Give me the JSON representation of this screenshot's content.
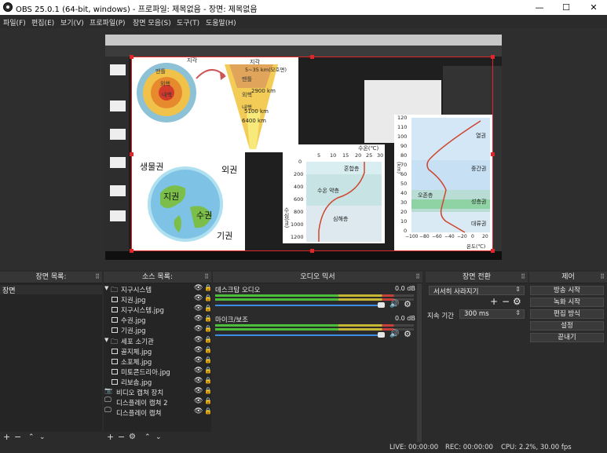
{
  "window": {
    "title": "OBS 25.0.1 (64-bit, windows) - 프로파일: 제목없음 - 장면: 제목없음",
    "minimize": "—",
    "maximize": "☐",
    "close": "✕"
  },
  "menu": [
    "파일(F)",
    "편집(E)",
    "보기(V)",
    "프로파일(P)",
    "장면 모음(S)",
    "도구(T)",
    "도움말(H)"
  ],
  "preview": {
    "slide1": {
      "title": "지각",
      "crust_label": "지각",
      "crust_depth": "5~35 km(모호면)",
      "mantle": "맨틀",
      "outer_core": "외핵",
      "inner_core": "내핵",
      "d1": "2900 km",
      "d2": "5100 km",
      "d3": "6400 km"
    },
    "slide2": {
      "bio": "생물권",
      "outer": "외권",
      "geo": "지권",
      "hydro": "수권",
      "atmo": "기권"
    },
    "slide3": {
      "temp_axis": "수온(℃)",
      "ticks_x": [
        "5",
        "10",
        "15",
        "20",
        "25",
        "30"
      ],
      "ticks_y": [
        "0",
        "200",
        "400",
        "600",
        "800",
        "1000",
        "1200"
      ],
      "depth_axis": "수심(m)",
      "mixed": "혼합층",
      "thermocline": "수온 약층",
      "deep": "심해층"
    },
    "slide4": {
      "alt_axis": "(km)",
      "ticks_y": [
        "120",
        "110",
        "100",
        "90",
        "80",
        "70",
        "60",
        "50",
        "40",
        "30",
        "20",
        "10",
        "0"
      ],
      "ticks_x": [
        "−100",
        "−80",
        "−60",
        "−40",
        "−20",
        "0",
        "20"
      ],
      "temp_axis": "온도(℃)",
      "thermo": "열권",
      "meso": "중간권",
      "ozone": "오존층",
      "strato": "성층권",
      "tropo": "대류권"
    }
  },
  "scenes": {
    "header": "장면 목록:",
    "items": [
      "장면"
    ]
  },
  "sources": {
    "header": "소스 목록:",
    "items": [
      {
        "label": "지구시스템",
        "type": "group"
      },
      {
        "label": "지권.jpg",
        "type": "image"
      },
      {
        "label": "지구시스템.jpg",
        "type": "image"
      },
      {
        "label": "수권.jpg",
        "type": "image"
      },
      {
        "label": "기권.jpg",
        "type": "image"
      },
      {
        "label": "세포 소기관",
        "type": "group"
      },
      {
        "label": "골지체.jpg",
        "type": "image"
      },
      {
        "label": "소포체.jpg",
        "type": "image"
      },
      {
        "label": "미토콘드리아.jpg",
        "type": "image"
      },
      {
        "label": "리보솜.jpg",
        "type": "image"
      },
      {
        "label": "비디오 캡쳐 장치",
        "type": "camera"
      },
      {
        "label": "디스플레이 캡쳐 2",
        "type": "display"
      },
      {
        "label": "디스플레이 캡쳐",
        "type": "display"
      }
    ]
  },
  "mixer": {
    "header": "오디오 믹서",
    "channels": [
      {
        "name": "데스크탑 오디오",
        "db": "0.0 dB",
        "level": 0.9
      },
      {
        "name": "마이크/보조",
        "db": "0.0 dB",
        "level": 0.9
      }
    ]
  },
  "transitions": {
    "header": "장면 전환",
    "selected": "서서히 사라지기",
    "duration_label": "지속 기간",
    "duration": "300 ms"
  },
  "controls": {
    "header": "제어",
    "buttons": [
      "방송 시작",
      "녹화 시작",
      "편집 방식",
      "설정",
      "끝내기"
    ]
  },
  "status": {
    "live": "LIVE: 00:00:00",
    "rec": "REC: 00:00:00",
    "cpu": "CPU: 2.2%, 30.00 fps"
  },
  "colors": {
    "selection": "#e0262d",
    "meter_green": "#4bbf3a",
    "meter_yellow": "#c7b633",
    "meter_red": "#c8403c",
    "volume_blue": "#3a8ee6"
  }
}
